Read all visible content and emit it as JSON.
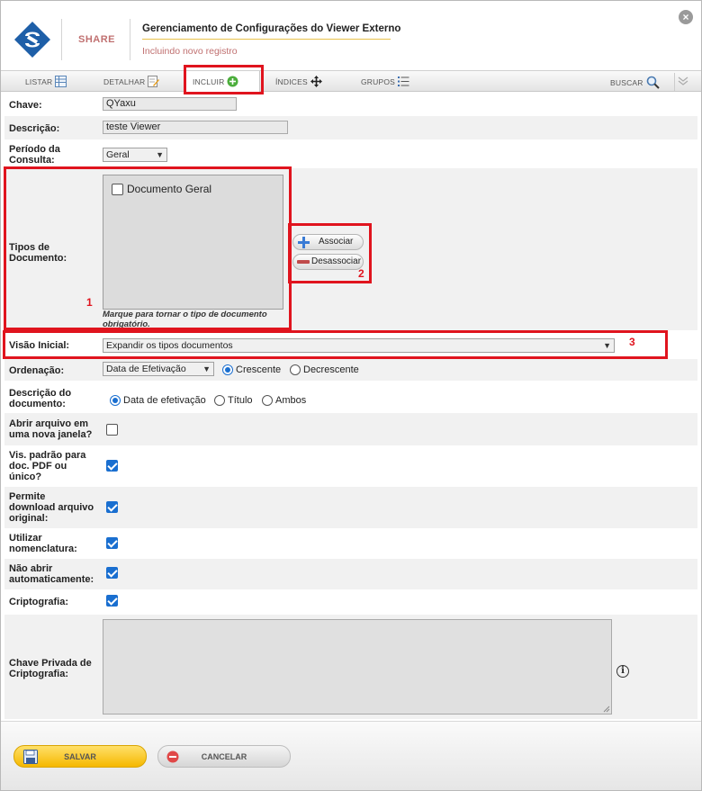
{
  "header": {
    "brand": "SHARE",
    "title": "Gerenciamento de Configurações do Viewer Externo",
    "subtitle": "Incluindo novo registro",
    "close_icon": "close-icon"
  },
  "toolbar": {
    "listar": "LISTAR",
    "detalhar": "DETALHAR",
    "incluir": "INCLUIR",
    "indices": "ÍNDICES",
    "grupos": "GRUPOS",
    "buscar": "BUSCAR"
  },
  "form": {
    "chave": {
      "label": "Chave:",
      "value": "QYaxu"
    },
    "descricao": {
      "label": "Descrição:",
      "value": "teste Viewer"
    },
    "periodo": {
      "label_1": "Período da",
      "label_2": "Consulta:",
      "selected": "Geral"
    },
    "tipos": {
      "label_1": "Tipos de",
      "label_2": "Documento:",
      "item": "Documento Geral",
      "hint_1": "Marque para tornar o tipo de documento",
      "hint_2": "obrigatório.",
      "associar": "Associar",
      "desassociar": "Desassociar"
    },
    "visao": {
      "label": "Visão Inicial:",
      "selected": "Expandir os tipos documentos"
    },
    "ordenacao": {
      "label": "Ordenação:",
      "selected": "Data de Efetivação",
      "opt_asc": "Crescente",
      "opt_desc": "Decrescente"
    },
    "descricao_doc": {
      "label_1": "Descrição do",
      "label_2": "documento:",
      "opt_1": "Data de efetivação",
      "opt_2": "Título",
      "opt_3": "Ambos"
    },
    "abrir_janela": {
      "label_1": "Abrir arquivo em",
      "label_2": "uma nova janela?"
    },
    "vis_padrao": {
      "label_1": "Vis. padrão para",
      "label_2": "doc. PDF ou",
      "label_3": "único?"
    },
    "permite_download": {
      "label_1": "Permite",
      "label_2": "download arquivo",
      "label_3": "original:"
    },
    "nomenclatura": {
      "label_1": "Utilizar",
      "label_2": "nomenclatura:"
    },
    "nao_abrir": {
      "label_1": "Não abrir",
      "label_2": "automaticamente:"
    },
    "criptografia": {
      "label": "Criptografia:"
    },
    "chave_privada": {
      "label_1": "Chave Privada de",
      "label_2": "Criptografia:"
    }
  },
  "annotations": {
    "n1": "1",
    "n2": "2",
    "n3": "3"
  },
  "footer": {
    "salvar": "SALVAR",
    "cancelar": "CANCELAR"
  },
  "colors": {
    "highlight": "#e0141e",
    "accent": "#1a6fd0",
    "save": "#f5b800"
  }
}
